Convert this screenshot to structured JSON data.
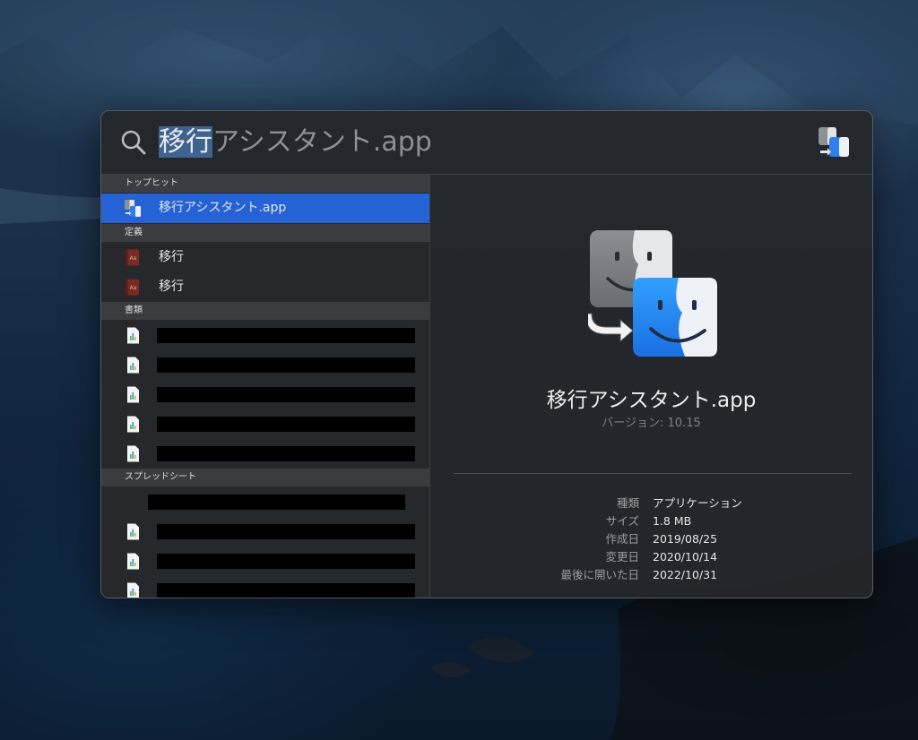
{
  "search": {
    "query_selected": "移行",
    "query_rest": "アシスタント.app"
  },
  "sections": {
    "top_hit": "トップヒット",
    "definitions": "定義",
    "documents": "書類",
    "spreadsheets": "スプレッドシート"
  },
  "results": {
    "top_hit": {
      "label": "移行アシスタント.app",
      "icon": "migration-assistant-icon"
    },
    "definitions": [
      {
        "label": "移行",
        "icon": "dictionary-icon"
      },
      {
        "label": "移行",
        "icon": "dictionary-icon"
      }
    ]
  },
  "preview": {
    "title": "移行アシスタント.app",
    "version": "バージョン: 10.15",
    "metadata": [
      {
        "key": "種類",
        "value": "アプリケーション"
      },
      {
        "key": "サイズ",
        "value": "1.8 MB"
      },
      {
        "key": "作成日",
        "value": "2019/08/25"
      },
      {
        "key": "変更日",
        "value": "2020/10/14"
      },
      {
        "key": "最後に開いた日",
        "value": "2022/10/31"
      }
    ]
  },
  "colors": {
    "selection": "#2462d6",
    "text_selection": "#3f638f",
    "panel": "#26282c"
  }
}
